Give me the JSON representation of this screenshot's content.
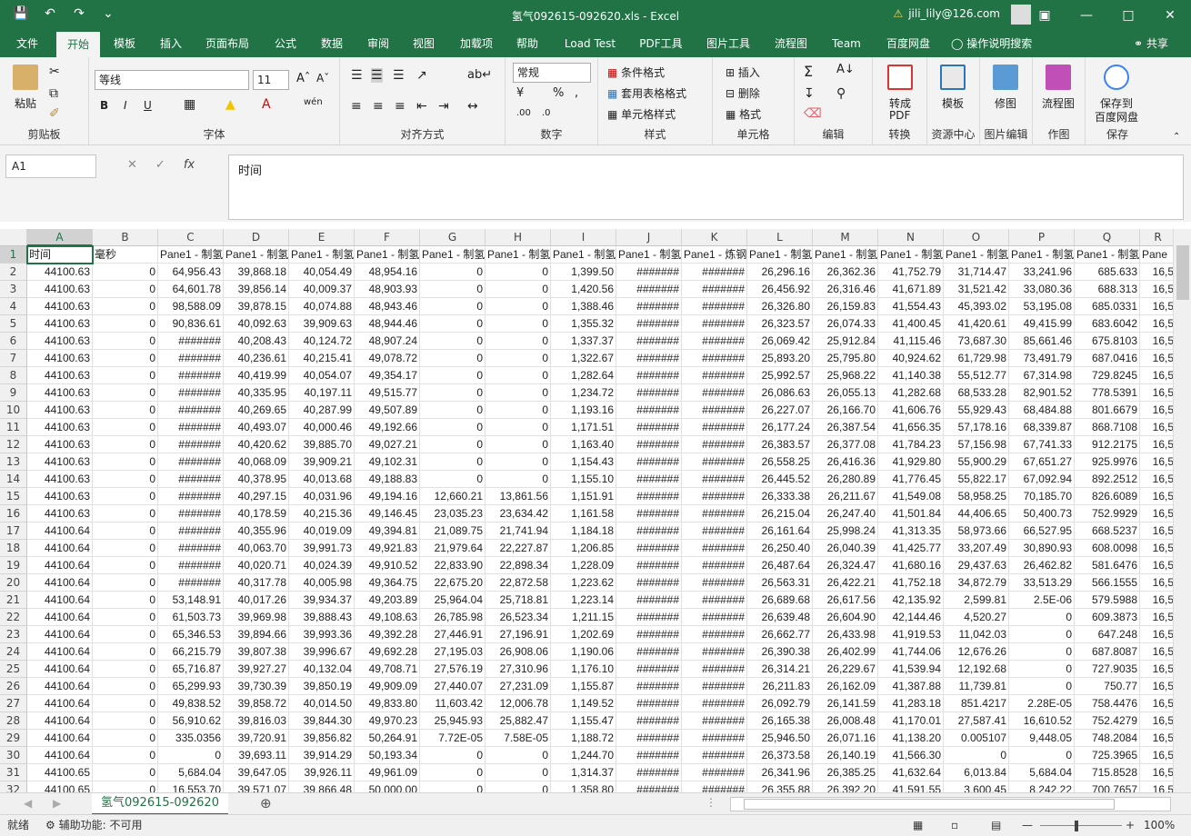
{
  "window": {
    "title": "氢气092615-092620.xls  -  Excel",
    "user": "jili_lily@126.com",
    "warning_icon": "warning-icon"
  },
  "menu": {
    "tabs": [
      "文件",
      "开始",
      "模板",
      "插入",
      "页面布局",
      "公式",
      "数据",
      "审阅",
      "视图",
      "加载项",
      "帮助",
      "Load Test",
      "PDF工具",
      "图片工具",
      "流程图",
      "Team",
      "百度网盘"
    ],
    "active": "开始",
    "tellme": "操作说明搜索",
    "share": "共享"
  },
  "ribbon": {
    "clipboard": {
      "paste": "粘贴",
      "label": "剪贴板"
    },
    "font": {
      "name": "等线",
      "size": "11",
      "label": "字体",
      "bold": "B",
      "italic": "I",
      "underline": "U",
      "phonetic": "wén"
    },
    "align": {
      "label": "对齐方式"
    },
    "number": {
      "format": "常规",
      "label": "数字",
      "percent": "%",
      "comma": ","
    },
    "styles": {
      "cond": "条件格式",
      "table": "套用表格格式",
      "cell": "单元格样式",
      "label": "样式"
    },
    "cells": {
      "insert": "插入",
      "delete": "删除",
      "format": "格式",
      "label": "单元格"
    },
    "edit": {
      "label": "编辑"
    },
    "convert": {
      "btn1": "转成",
      "btn2": "PDF",
      "label": "转换"
    },
    "resource": {
      "btn": "模板",
      "label": "资源中心"
    },
    "image": {
      "btn": "修图",
      "label": "图片编辑"
    },
    "draw": {
      "btn": "流程图",
      "label": "作图"
    },
    "save": {
      "btn1": "保存到",
      "btn2": "百度网盘",
      "label": "保存"
    }
  },
  "formula": {
    "namebox": "A1",
    "value": "时间",
    "fx": "fx"
  },
  "columns": [
    "A",
    "B",
    "C",
    "D",
    "E",
    "F",
    "G",
    "H",
    "I",
    "J",
    "K",
    "L",
    "M",
    "N",
    "O",
    "P",
    "Q",
    "R"
  ],
  "header_row": [
    "时间",
    "毫秒",
    "Pane1 - 制氢",
    "Pane1 - 制氢",
    "Pane1 - 制氢",
    "Pane1 - 制氢",
    "Pane1 - 制氢",
    "Pane1 - 制氢",
    "Pane1 - 制氢",
    "Pane1 - 制氢",
    "Pane1 - 炼钢",
    "Pane1 - 制氢",
    "Pane1 - 制氢",
    "Pane1 - 制氢",
    "Pane1 - 制氢",
    "Pane1 - 制氢",
    "Pane1 - 制氢",
    "Pane"
  ],
  "rows": [
    [
      "44100.63",
      "0",
      "64,956.43",
      "39,868.18",
      "40,054.49",
      "48,954.16",
      "0",
      "0",
      "1,399.50",
      "#######",
      "#######",
      "26,296.16",
      "26,362.36",
      "41,752.79",
      "31,714.47",
      "33,241.96",
      "685.633",
      "16,5"
    ],
    [
      "44100.63",
      "0",
      "64,601.78",
      "39,856.14",
      "40,009.37",
      "48,903.93",
      "0",
      "0",
      "1,420.56",
      "#######",
      "#######",
      "26,456.92",
      "26,316.46",
      "41,671.89",
      "31,521.42",
      "33,080.36",
      "688.313",
      "16,5"
    ],
    [
      "44100.63",
      "0",
      "98,588.09",
      "39,878.15",
      "40,074.88",
      "48,943.46",
      "0",
      "0",
      "1,388.46",
      "#######",
      "#######",
      "26,326.80",
      "26,159.83",
      "41,554.43",
      "45,393.02",
      "53,195.08",
      "685.0331",
      "16,5"
    ],
    [
      "44100.63",
      "0",
      "90,836.61",
      "40,092.63",
      "39,909.63",
      "48,944.46",
      "0",
      "0",
      "1,355.32",
      "#######",
      "#######",
      "26,323.57",
      "26,074.33",
      "41,400.45",
      "41,420.61",
      "49,415.99",
      "683.6042",
      "16,5"
    ],
    [
      "44100.63",
      "0",
      "#######",
      "40,208.43",
      "40,124.72",
      "48,907.24",
      "0",
      "0",
      "1,337.37",
      "#######",
      "#######",
      "26,069.42",
      "25,912.84",
      "41,115.46",
      "73,687.30",
      "85,661.46",
      "675.8103",
      "16,5"
    ],
    [
      "44100.63",
      "0",
      "#######",
      "40,236.61",
      "40,215.41",
      "49,078.72",
      "0",
      "0",
      "1,322.67",
      "#######",
      "#######",
      "25,893.20",
      "25,795.80",
      "40,924.62",
      "61,729.98",
      "73,491.79",
      "687.0416",
      "16,5"
    ],
    [
      "44100.63",
      "0",
      "#######",
      "40,419.99",
      "40,054.07",
      "49,354.17",
      "0",
      "0",
      "1,282.64",
      "#######",
      "#######",
      "25,992.57",
      "25,968.22",
      "41,140.38",
      "55,512.77",
      "67,314.98",
      "729.8245",
      "16,5"
    ],
    [
      "44100.63",
      "0",
      "#######",
      "40,335.95",
      "40,197.11",
      "49,515.77",
      "0",
      "0",
      "1,234.72",
      "#######",
      "#######",
      "26,086.63",
      "26,055.13",
      "41,282.68",
      "68,533.28",
      "82,901.52",
      "778.5391",
      "16,5"
    ],
    [
      "44100.63",
      "0",
      "#######",
      "40,269.65",
      "40,287.99",
      "49,507.89",
      "0",
      "0",
      "1,193.16",
      "#######",
      "#######",
      "26,227.07",
      "26,166.70",
      "41,606.76",
      "55,929.43",
      "68,484.88",
      "801.6679",
      "16,5"
    ],
    [
      "44100.63",
      "0",
      "#######",
      "40,493.07",
      "40,000.46",
      "49,192.66",
      "0",
      "0",
      "1,171.51",
      "#######",
      "#######",
      "26,177.24",
      "26,387.54",
      "41,656.35",
      "57,178.16",
      "68,339.87",
      "868.7108",
      "16,5"
    ],
    [
      "44100.63",
      "0",
      "#######",
      "40,420.62",
      "39,885.70",
      "49,027.21",
      "0",
      "0",
      "1,163.40",
      "#######",
      "#######",
      "26,383.57",
      "26,377.08",
      "41,784.23",
      "57,156.98",
      "67,741.33",
      "912.2175",
      "16,5"
    ],
    [
      "44100.63",
      "0",
      "#######",
      "40,068.09",
      "39,909.21",
      "49,102.31",
      "0",
      "0",
      "1,154.43",
      "#######",
      "#######",
      "26,558.25",
      "26,416.36",
      "41,929.80",
      "55,900.29",
      "67,651.27",
      "925.9976",
      "16,5"
    ],
    [
      "44100.63",
      "0",
      "#######",
      "40,378.95",
      "40,013.68",
      "49,188.83",
      "0",
      "0",
      "1,155.10",
      "#######",
      "#######",
      "26,445.52",
      "26,280.89",
      "41,776.45",
      "55,822.17",
      "67,092.94",
      "892.2512",
      "16,5"
    ],
    [
      "44100.63",
      "0",
      "#######",
      "40,297.15",
      "40,031.96",
      "49,194.16",
      "12,660.21",
      "13,861.56",
      "1,151.91",
      "#######",
      "#######",
      "26,333.38",
      "26,211.67",
      "41,549.08",
      "58,958.25",
      "70,185.70",
      "826.6089",
      "16,5"
    ],
    [
      "44100.63",
      "0",
      "#######",
      "40,178.59",
      "40,215.36",
      "49,146.45",
      "23,035.23",
      "23,634.42",
      "1,161.58",
      "#######",
      "#######",
      "26,215.04",
      "26,247.40",
      "41,501.84",
      "44,406.65",
      "50,400.73",
      "752.9929",
      "16,5"
    ],
    [
      "44100.64",
      "0",
      "#######",
      "40,355.96",
      "40,019.09",
      "49,394.81",
      "21,089.75",
      "21,741.94",
      "1,184.18",
      "#######",
      "#######",
      "26,161.64",
      "25,998.24",
      "41,313.35",
      "58,973.66",
      "66,527.95",
      "668.5237",
      "16,5"
    ],
    [
      "44100.64",
      "0",
      "#######",
      "40,063.70",
      "39,991.73",
      "49,921.83",
      "21,979.64",
      "22,227.87",
      "1,206.85",
      "#######",
      "#######",
      "26,250.40",
      "26,040.39",
      "41,425.77",
      "33,207.49",
      "30,890.93",
      "608.0098",
      "16,5"
    ],
    [
      "44100.64",
      "0",
      "#######",
      "40,020.71",
      "40,024.39",
      "49,910.52",
      "22,833.90",
      "22,898.34",
      "1,228.09",
      "#######",
      "#######",
      "26,487.64",
      "26,324.47",
      "41,680.16",
      "29,437.63",
      "26,462.82",
      "581.6476",
      "16,5"
    ],
    [
      "44100.64",
      "0",
      "#######",
      "40,317.78",
      "40,005.98",
      "49,364.75",
      "22,675.20",
      "22,872.58",
      "1,223.62",
      "#######",
      "#######",
      "26,563.31",
      "26,422.21",
      "41,752.18",
      "34,872.79",
      "33,513.29",
      "566.1555",
      "16,5"
    ],
    [
      "44100.64",
      "0",
      "53,148.91",
      "40,017.26",
      "39,934.37",
      "49,203.89",
      "25,964.04",
      "25,718.81",
      "1,223.14",
      "#######",
      "#######",
      "26,689.68",
      "26,617.56",
      "42,135.92",
      "2,599.81",
      "2.5E-06",
      "579.5988",
      "16,5"
    ],
    [
      "44100.64",
      "0",
      "61,503.73",
      "39,969.98",
      "39,888.43",
      "49,108.63",
      "26,785.98",
      "26,523.34",
      "1,211.15",
      "#######",
      "#######",
      "26,639.48",
      "26,604.90",
      "42,144.46",
      "4,520.27",
      "0",
      "609.3873",
      "16,5"
    ],
    [
      "44100.64",
      "0",
      "65,346.53",
      "39,894.66",
      "39,993.36",
      "49,392.28",
      "27,446.91",
      "27,196.91",
      "1,202.69",
      "#######",
      "#######",
      "26,662.77",
      "26,433.98",
      "41,919.53",
      "11,042.03",
      "0",
      "647.248",
      "16,5"
    ],
    [
      "44100.64",
      "0",
      "66,215.79",
      "39,807.38",
      "39,996.67",
      "49,692.28",
      "27,195.03",
      "26,908.06",
      "1,190.06",
      "#######",
      "#######",
      "26,390.38",
      "26,402.99",
      "41,744.06",
      "12,676.26",
      "0",
      "687.8087",
      "16,5"
    ],
    [
      "44100.64",
      "0",
      "65,716.87",
      "39,927.27",
      "40,132.04",
      "49,708.71",
      "27,576.19",
      "27,310.96",
      "1,176.10",
      "#######",
      "#######",
      "26,314.21",
      "26,229.67",
      "41,539.94",
      "12,192.68",
      "0",
      "727.9035",
      "16,5"
    ],
    [
      "44100.64",
      "0",
      "65,299.93",
      "39,730.39",
      "39,850.19",
      "49,909.09",
      "27,440.07",
      "27,231.09",
      "1,155.87",
      "#######",
      "#######",
      "26,211.83",
      "26,162.09",
      "41,387.88",
      "11,739.81",
      "0",
      "750.77",
      "16,5"
    ],
    [
      "44100.64",
      "0",
      "49,838.52",
      "39,858.72",
      "40,014.50",
      "49,833.80",
      "11,603.42",
      "12,006.78",
      "1,149.52",
      "#######",
      "#######",
      "26,092.79",
      "26,141.59",
      "41,283.18",
      "851.4217",
      "2.28E-05",
      "758.4476",
      "16,5"
    ],
    [
      "44100.64",
      "0",
      "56,910.62",
      "39,816.03",
      "39,844.30",
      "49,970.23",
      "25,945.93",
      "25,882.47",
      "1,155.47",
      "#######",
      "#######",
      "26,165.38",
      "26,008.48",
      "41,170.01",
      "27,587.41",
      "16,610.52",
      "752.4279",
      "16,5"
    ],
    [
      "44100.64",
      "0",
      "335.0356",
      "39,720.91",
      "39,856.82",
      "50,264.91",
      "7.72E-05",
      "7.58E-05",
      "1,188.72",
      "#######",
      "#######",
      "25,946.50",
      "26,071.16",
      "41,138.20",
      "0.005107",
      "9,448.05",
      "748.2084",
      "16,5"
    ],
    [
      "44100.64",
      "0",
      "0",
      "39,693.11",
      "39,914.29",
      "50,193.34",
      "0",
      "0",
      "1,244.70",
      "#######",
      "#######",
      "26,373.58",
      "26,140.19",
      "41,566.30",
      "0",
      "0",
      "725.3965",
      "16,5"
    ],
    [
      "44100.65",
      "0",
      "5,684.04",
      "39,647.05",
      "39,926.11",
      "49,961.09",
      "0",
      "0",
      "1,314.37",
      "#######",
      "#######",
      "26,341.96",
      "26,385.25",
      "41,632.64",
      "6,013.84",
      "5,684.04",
      "715.8528",
      "16,5"
    ],
    [
      "44100.65",
      "0",
      "16,553.70",
      "39,571.07",
      "39,866.48",
      "50,000.00",
      "0",
      "0",
      "1,358.80",
      "#######",
      "#######",
      "26,355.88",
      "26,392.20",
      "41,591.55",
      "3,600.45",
      "8,242.22",
      "700.7657",
      "16,5"
    ]
  ],
  "sheet": {
    "name": "氢气092615-092620"
  },
  "status": {
    "ready": "就绪",
    "accessibility": "辅助功能: 不可用",
    "zoom": "100%"
  }
}
